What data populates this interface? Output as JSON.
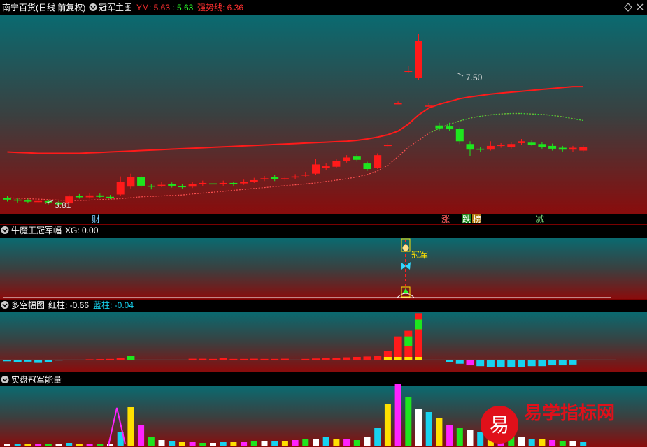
{
  "header": {
    "stock": "南宁百货(日线 前复权)",
    "indicator": "冠军主图",
    "ym_label": "YM: 5.63",
    "ym_sep": ":",
    "ym_value2": "5.63",
    "strong_label": "强势线: 6.36"
  },
  "panels": {
    "p2": {
      "title": "牛魔王冠军幅",
      "value": "XG: 0.00",
      "marker_text": "冠军"
    },
    "p3": {
      "title": "多空幅图",
      "red_label": "红柱: -0.66",
      "blue_label": "蓝柱: -0.04"
    },
    "p4": {
      "title": "实盘冠军能量"
    }
  },
  "annotations": {
    "high": "7.50",
    "low": "3.81",
    "tags": [
      "财",
      "涨",
      "跌",
      "榜",
      "减"
    ]
  },
  "watermark": {
    "glyph": "易",
    "text": "易学指标网"
  },
  "colors": {
    "up": "#ff1a1a",
    "down": "#1ee61e",
    "cyan": "#17d3f0",
    "magenta": "#ff22ff",
    "yellow": "#ffe000",
    "white": "#ffffff"
  },
  "chart_data": [
    {
      "type": "candlestick",
      "title": "冠军主图",
      "series": [
        {
          "name": "",
          "values": [
            [
              3.95,
              3.92,
              4.0,
              3.88
            ],
            [
              3.92,
              3.9,
              3.96,
              3.86
            ],
            [
              3.9,
              3.88,
              3.94,
              3.84
            ],
            [
              3.88,
              3.89,
              3.93,
              3.85
            ],
            [
              3.89,
              3.86,
              3.92,
              3.82
            ],
            [
              3.86,
              3.82,
              3.89,
              3.78
            ],
            [
              3.84,
              3.99,
              4.03,
              3.81
            ],
            [
              4.0,
              3.97,
              4.04,
              3.94
            ],
            [
              3.97,
              4.01,
              4.06,
              3.94
            ],
            [
              4.01,
              3.98,
              4.05,
              3.95
            ],
            [
              3.98,
              3.97,
              4.02,
              3.93
            ],
            [
              4.03,
              4.3,
              4.42,
              4.0
            ],
            [
              4.2,
              4.4,
              4.48,
              4.16
            ],
            [
              4.4,
              4.22,
              4.46,
              4.18
            ],
            [
              4.22,
              4.2,
              4.26,
              4.14
            ],
            [
              4.22,
              4.24,
              4.3,
              4.19
            ],
            [
              4.25,
              4.22,
              4.29,
              4.18
            ],
            [
              4.21,
              4.2,
              4.26,
              4.16
            ],
            [
              4.2,
              4.25,
              4.3,
              4.17
            ],
            [
              4.26,
              4.28,
              4.33,
              4.22
            ],
            [
              4.27,
              4.25,
              4.31,
              4.21
            ],
            [
              4.25,
              4.28,
              4.33,
              4.22
            ],
            [
              4.28,
              4.26,
              4.31,
              4.22
            ],
            [
              4.27,
              4.3,
              4.35,
              4.24
            ],
            [
              4.3,
              4.34,
              4.39,
              4.28
            ],
            [
              4.36,
              4.38,
              4.43,
              4.32
            ],
            [
              4.4,
              4.36,
              4.46,
              4.32
            ],
            [
              4.36,
              4.38,
              4.42,
              4.32
            ],
            [
              4.4,
              4.42,
              4.47,
              4.36
            ],
            [
              4.44,
              4.46,
              4.52,
              4.4
            ],
            [
              4.48,
              4.68,
              4.8,
              4.45
            ],
            [
              4.6,
              4.64,
              4.7,
              4.55
            ],
            [
              4.63,
              4.75,
              4.8,
              4.6
            ],
            [
              4.76,
              4.83,
              4.88,
              4.72
            ],
            [
              4.85,
              4.78,
              4.9,
              4.74
            ],
            [
              4.7,
              4.58,
              4.74,
              4.54
            ],
            [
              4.6,
              4.88,
              4.92,
              4.58
            ],
            [
              5.1,
              5.1,
              5.14,
              5.04
            ],
            [
              6.0,
              6.0,
              6.04,
              5.98
            ],
            [
              6.7,
              6.7,
              6.8,
              6.66
            ],
            [
              6.55,
              7.35,
              7.5,
              6.5
            ],
            [
              5.95,
              5.95,
              6.0,
              5.88
            ],
            [
              5.52,
              5.46,
              5.58,
              5.4
            ],
            [
              5.5,
              5.44,
              5.58,
              5.4
            ],
            [
              5.45,
              5.18,
              5.48,
              5.12
            ],
            [
              5.12,
              5.0,
              5.18,
              4.86
            ],
            [
              5.02,
              5.0,
              5.06,
              4.95
            ],
            [
              5.0,
              5.08,
              5.18,
              4.98
            ],
            [
              5.08,
              5.1,
              5.14,
              5.04
            ],
            [
              5.06,
              5.12,
              5.16,
              5.02
            ],
            [
              5.14,
              5.18,
              5.23,
              5.1
            ],
            [
              5.15,
              5.1,
              5.2,
              5.08
            ],
            [
              5.12,
              5.06,
              5.16,
              5.02
            ],
            [
              5.08,
              5.02,
              5.13,
              4.98
            ],
            [
              5.04,
              5.0,
              5.08,
              4.96
            ],
            [
              5.0,
              5.04,
              5.08,
              4.95
            ],
            [
              4.98,
              5.05,
              5.1,
              4.94
            ]
          ]
        }
      ],
      "lines": [
        {
          "name": "强势线",
          "values": [
            4.95,
            4.94,
            4.93,
            4.92,
            4.92,
            4.92,
            4.92,
            4.92,
            4.93,
            4.94,
            4.95,
            4.96,
            4.97,
            4.98,
            4.99,
            5.0,
            5.01,
            5.02,
            5.03,
            5.04,
            5.05,
            5.06,
            5.07,
            5.08,
            5.09,
            5.1,
            5.11,
            5.12,
            5.13,
            5.14,
            5.15,
            5.16,
            5.17,
            5.18,
            5.2,
            5.23,
            5.27,
            5.32,
            5.4,
            5.55,
            5.75,
            5.9,
            5.98,
            6.04,
            6.1,
            6.14,
            6.17,
            6.2,
            6.22,
            6.24,
            6.26,
            6.28,
            6.3,
            6.32,
            6.34,
            6.36,
            6.36
          ]
        },
        {
          "name": "YM",
          "values": [
            3.96,
            3.95,
            3.94,
            3.93,
            3.92,
            3.91,
            3.9,
            3.9,
            3.91,
            3.92,
            3.93,
            3.94,
            3.96,
            3.98,
            3.99,
            4.0,
            4.01,
            4.02,
            4.04,
            4.06,
            4.08,
            4.1,
            4.12,
            4.14,
            4.16,
            4.18,
            4.2,
            4.22,
            4.24,
            4.26,
            4.28,
            4.31,
            4.34,
            4.37,
            4.41,
            4.46,
            4.54,
            4.66,
            4.85,
            5.05,
            5.2,
            5.35,
            5.46,
            5.55,
            5.62,
            5.68,
            5.72,
            5.75,
            5.77,
            5.78,
            5.78,
            5.77,
            5.76,
            5.74,
            5.71,
            5.67,
            5.63
          ]
        }
      ],
      "ylim": [
        3.6,
        7.9
      ]
    },
    {
      "type": "bar",
      "title": "多空幅图",
      "series": [
        {
          "name": "红柱",
          "values": [
            0,
            0,
            0,
            0,
            0,
            0,
            0,
            0,
            0.05,
            0.08,
            0.1,
            0.25,
            0.45,
            0,
            0,
            0,
            0,
            0,
            0.12,
            0.12,
            0.1,
            0.18,
            0.1,
            0.1,
            0.12,
            0.1,
            0.1,
            0.12,
            0,
            0.1,
            0.15,
            0.2,
            0.25,
            0.3,
            0.35,
            0.4,
            0.5,
            1.05,
            2.9,
            3.6,
            5.8,
            0,
            0,
            0,
            0,
            0,
            0,
            0,
            0,
            0,
            0,
            0,
            0,
            0,
            0,
            0,
            0
          ]
        },
        {
          "name": "蓝柱",
          "values": [
            -0.2,
            -0.3,
            -0.25,
            -0.4,
            -0.3,
            -0.1,
            -0.06,
            0,
            0,
            0,
            0,
            0,
            0,
            0,
            0,
            0,
            0,
            0,
            0,
            0,
            0,
            0,
            0,
            0,
            0,
            0,
            0,
            0,
            0,
            0,
            0,
            0,
            0,
            0,
            0,
            0,
            0,
            0,
            0,
            0,
            0,
            0,
            0,
            -0.3,
            -0.5,
            -0.7,
            -0.8,
            -0.95,
            -0.95,
            -0.9,
            -0.9,
            -0.8,
            -0.8,
            -0.7,
            -0.7,
            -0.6,
            -0.04
          ]
        }
      ]
    }
  ]
}
